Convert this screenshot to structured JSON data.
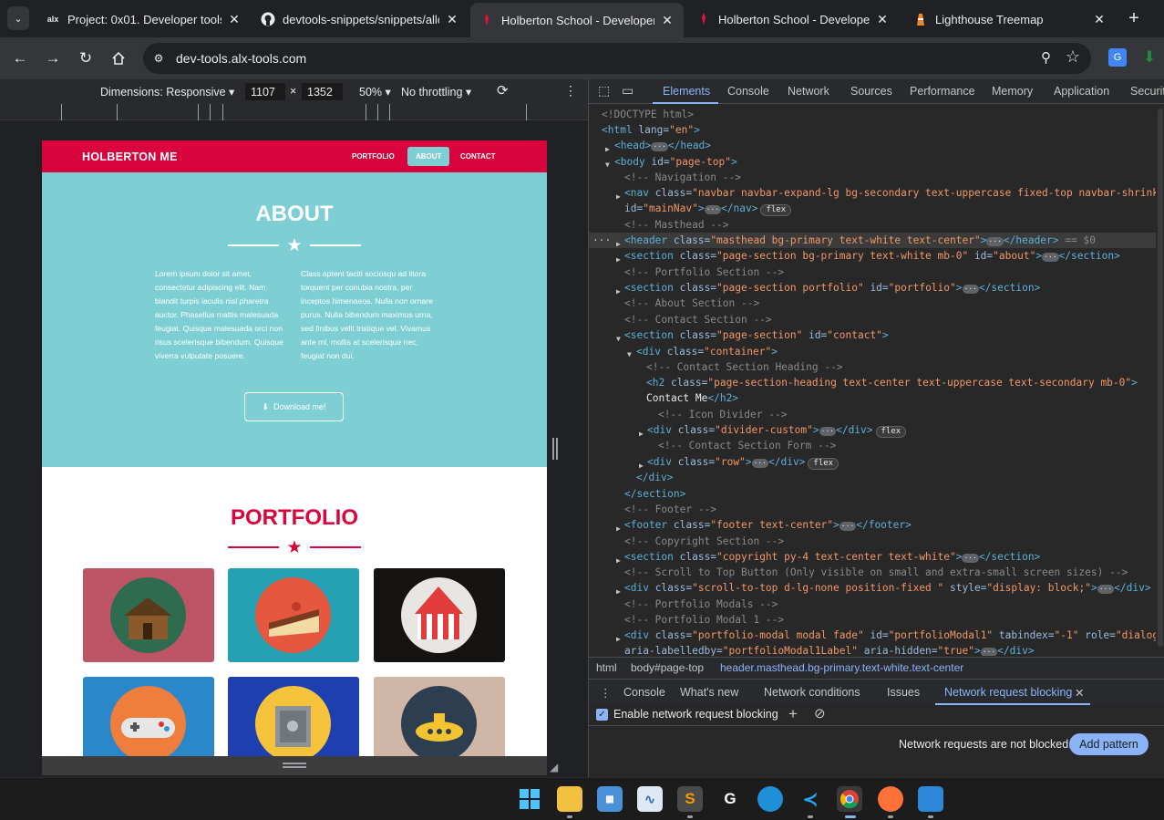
{
  "browser": {
    "tabs": [
      {
        "title": "Project: 0x01. Developer tools |",
        "favicon": "alx-icon",
        "active": false
      },
      {
        "title": "devtools-snippets/snippets/allc",
        "favicon": "github-icon",
        "active": false
      },
      {
        "title": "Holberton School - Developer t",
        "favicon": "holberton-icon",
        "active": true
      },
      {
        "title": "Holberton School - Developer t",
        "favicon": "holberton-icon",
        "active": false
      },
      {
        "title": "Lighthouse Treemap",
        "favicon": "lighthouse-icon",
        "active": false
      }
    ],
    "favicon_text": {
      "alx": "alx"
    },
    "url": "dev-tools.alx-tools.com",
    "new_tab_label": "+"
  },
  "device_toolbar": {
    "dimensions_label": "Dimensions: Responsive",
    "width": "1107",
    "times": "×",
    "height": "1352",
    "zoom": "50%",
    "throttling": "No throttling"
  },
  "site": {
    "brand": "HOLBERTON ME",
    "nav": [
      "PORTFOLIO",
      "ABOUT",
      "CONTACT"
    ],
    "about_title": "ABOUT",
    "about_left": "Lorem ipsum dolor sit amet, consectetur adipiscing elit. Nam blandit turpis iaculis nisl pharetra auctor. Phasellus mattis malesuada feugiat. Quisque malesuada orci non risus scelerisque bibendum. Quisque viverra vulputate posuere.",
    "about_right": "Class aptent taciti sociosqu ad litora torquent per conubia nostra, per inceptos himenaeos. Nulla non ornare purus. Nulla bibendum maximus urna, sed finibus velit tristique vel. Vivamus ante mi, mollis at scelerisque nec, feugiat non dui.",
    "download_label": "Download me!",
    "portfolio_title": "PORTFOLIO",
    "colors": {
      "primary": "#d9043e",
      "teal": "#7ecfd4"
    }
  },
  "devtools": {
    "tabs": [
      "Elements",
      "Console",
      "Network",
      "Sources",
      "Performance",
      "Memory",
      "Application",
      "Security"
    ],
    "active_tab": "Elements",
    "dom_lines": {
      "l0": "<!DOCTYPE html>",
      "l1_tag": "<html",
      "l1_attr": " lang=",
      "l1_val": "\"en\"",
      "l1_end": ">",
      "l2": "<head>",
      "l2b": "</head>",
      "l3_tag": "<body",
      "l3_attr": " id=",
      "l3_val": "\"page-top\"",
      "l3_end": ">",
      "c_nav": "<!-- Navigation -->",
      "l5_tag": "<nav",
      "l5_attr": " class=",
      "l5_val": "\"navbar navbar-expand-lg bg-secondary text-uppercase fixed-top navbar-shrink\"",
      "l6_attr": "id=",
      "l6_val": "\"mainNav\"",
      "l6_end": "</nav>",
      "c_masthead": "<!-- Masthead -->",
      "l8_tag": "<header",
      "l8_attr": " class=",
      "l8_val": "\"masthead bg-primary text-white text-center\"",
      "l8_end": "</header>",
      "l8_sel": "== $0",
      "l9_tag": "<section",
      "l9_attr": " class=",
      "l9_val": "\"page-section bg-primary text-white mb-0\"",
      "l9_attr2": " id=",
      "l9_val2": "\"about\"",
      "l9_end": "</section>",
      "c_portfolio": "<!-- Portfolio Section -->",
      "l11_tag": "<section",
      "l11_attr": " class=",
      "l11_val": "\"page-section portfolio\"",
      "l11_attr2": " id=",
      "l11_val2": "\"portfolio\"",
      "l11_end": "</section>",
      "c_about": "<!-- About Section -->",
      "c_contact": "<!-- Contact Section -->",
      "l14_tag": "<section",
      "l14_attr": " class=",
      "l14_val": "\"page-section\"",
      "l14_attr2": " id=",
      "l14_val2": "\"contact\"",
      "l14_end": ">",
      "l15_tag": "<div",
      "l15_attr": " class=",
      "l15_val": "\"container\"",
      "l15_end": ">",
      "c_heading": "<!-- Contact Section Heading -->",
      "l17_tag": "<h2",
      "l17_attr": " class=",
      "l17_val": "\"page-section-heading text-center text-uppercase text-secondary mb-0\"",
      "l17_end": ">",
      "l18_text": "Contact Me",
      "l18_end": "</h2>",
      "c_icon": "<!-- Icon Divider -->",
      "l20_tag": "<div",
      "l20_attr": " class=",
      "l20_val": "\"divider-custom\"",
      "l20_end": "</div>",
      "c_form": "<!-- Contact Section Form -->",
      "l22_tag": "<div",
      "l22_attr": " class=",
      "l22_val": "\"row\"",
      "l22_end": "</div>",
      "l23": "</div>",
      "l24": "</section>",
      "c_footer": "<!-- Footer -->",
      "l26_tag": "<footer",
      "l26_attr": " class=",
      "l26_val": "\"footer text-center\"",
      "l26_end": "</footer>",
      "c_copyright": "<!-- Copyright Section -->",
      "l28_tag": "<section",
      "l28_attr": " class=",
      "l28_val": "\"copyright py-4 text-center text-white\"",
      "l28_end": "</section>",
      "c_scroll": "<!-- Scroll to Top Button (Only visible on small and extra-small screen sizes) -->",
      "l30_tag": "<div",
      "l30_attr": " class=",
      "l30_val": "\"scroll-to-top d-lg-none position-fixed \"",
      "l30_attr2": " style=",
      "l30_val2": "\"display: block;\"",
      "l30_end": "</div>",
      "c_modals": "<!-- Portfolio Modals -->",
      "c_modal1": "<!-- Portfolio Modal 1 -->",
      "l33_tag": "<div",
      "l33_attr": " class=",
      "l33_val": "\"portfolio-modal modal fade\"",
      "l33_attr2": " id=",
      "l33_val2": "\"portfolioModal1\"",
      "l33_attr3": " tabindex=",
      "l33_val3": "\"-1\"",
      "l33_attr4": " role=",
      "l33_val4": "\"dialog\"",
      "l34_attr": "aria-labelledby=",
      "l34_val": "\"portfolioModal1Label\"",
      "l34_attr2": " aria-hidden=",
      "l34_val2": "\"true\"",
      "l34_end": "</div>",
      "badge": "flex",
      "ellipsis": "···"
    },
    "breadcrumbs": [
      "html",
      "body#page-top",
      "header.masthead.bg-primary.text-white.text-center"
    ],
    "drawer_tabs": [
      "Console",
      "What's new",
      "Network conditions",
      "Issues",
      "Network request blocking"
    ],
    "enable_blocking_label": "Enable network request blocking",
    "enable_blocking_checked": true,
    "not_blocked_text": "Network requests are not blocked.",
    "add_pattern_label": "Add pattern"
  },
  "taskbar": {
    "icons": [
      "windows-start-icon",
      "file-explorer-icon",
      "control-panel-icon",
      "task-manager-icon",
      "sublime-text-icon",
      "github-desktop-icon",
      "edge-icon",
      "vscode-icon",
      "chrome-icon",
      "firefox-icon",
      "paint-icon"
    ]
  }
}
